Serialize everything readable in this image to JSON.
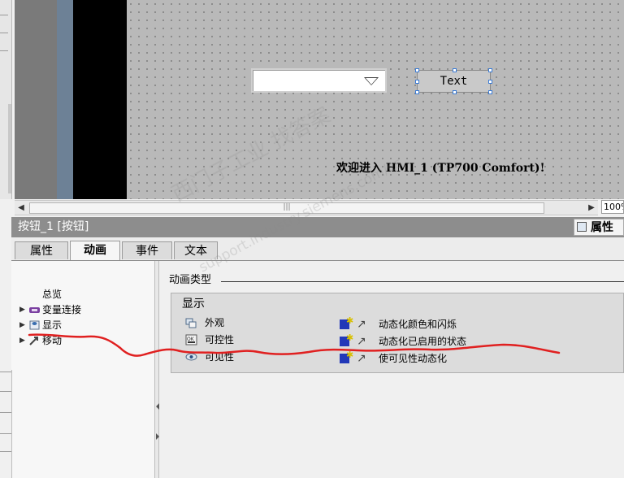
{
  "canvas": {
    "text_button_label": "Text",
    "welcome_text": "欢迎进入 HMI_1 (TP700 Comfort)!",
    "zoom_value": "100%"
  },
  "inspector": {
    "title": "按钮_1 [按钮]",
    "properties_button": "属性",
    "tabs": [
      {
        "label": "属性",
        "active": false
      },
      {
        "label": "动画",
        "active": true
      },
      {
        "label": "事件",
        "active": false
      },
      {
        "label": "文本",
        "active": false
      }
    ]
  },
  "tree": {
    "items": [
      {
        "label": "总览",
        "icon": "none",
        "expandable": false
      },
      {
        "label": "变量连接",
        "icon": "tag-connection-icon",
        "expandable": true
      },
      {
        "label": "显示",
        "icon": "display-icon",
        "expandable": true
      },
      {
        "label": "移动",
        "icon": "move-icon",
        "expandable": true
      }
    ]
  },
  "content": {
    "section_heading": "动画类型",
    "display_group_title": "显示",
    "display_items": [
      {
        "label": "外观",
        "icon": "appearance-icon"
      },
      {
        "label": "可控性",
        "icon": "operability-icon"
      },
      {
        "label": "可见性",
        "icon": "visibility-icon"
      }
    ],
    "animation_actions": [
      {
        "label": "动态化颜色和闪烁",
        "icon": "add-animation-icon"
      },
      {
        "label": "动态化已启用的状态",
        "icon": "add-animation-icon"
      },
      {
        "label": "使可见性动态化",
        "icon": "add-animation-icon"
      }
    ]
  },
  "watermark": {
    "line1": "西门子工业 找答案",
    "line2": "support.industry.siemens.com/cs"
  },
  "colors": {
    "canvas_bg": "#b9b9b9",
    "title_bar": "#8d8d8d",
    "annotation_stroke": "#e02020",
    "animation_cube": "#2238b8"
  }
}
